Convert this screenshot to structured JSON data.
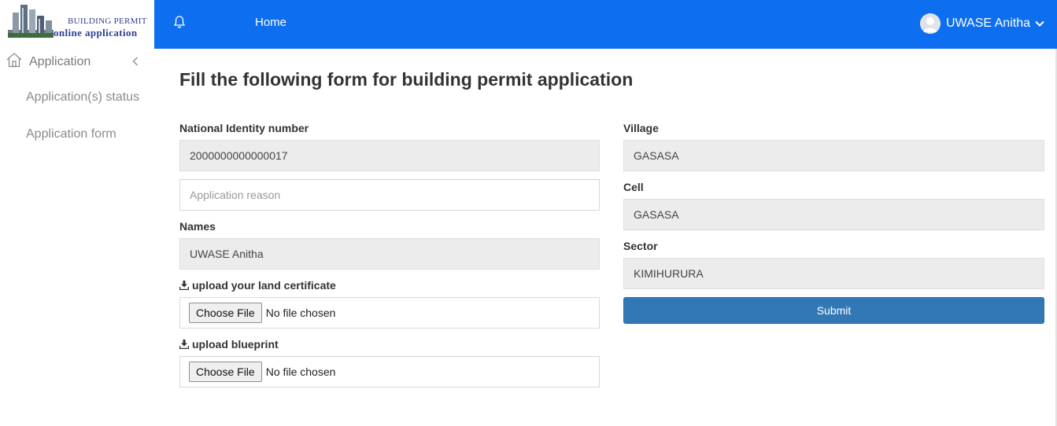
{
  "logo": {
    "line1": "BUILDING PERMIT",
    "line2": "online application"
  },
  "topbar": {
    "bell_icon": "bell-icon",
    "home_label": "Home",
    "user_name": "UWASE Anitha",
    "color": "#0d6ef0"
  },
  "sidebar": {
    "application_label": "Application",
    "items": [
      {
        "label": "Application(s) status"
      },
      {
        "label": "Application form"
      }
    ]
  },
  "form": {
    "title": "Fill the following form for building permit application",
    "national_id_label": "National Identity number",
    "national_id_value": "2000000000000017",
    "reason_placeholder": "Application reason",
    "names_label": "Names",
    "names_value": "UWASE Anitha",
    "land_cert_label": "upload your land certificate",
    "blueprint_label": "upload blueprint",
    "choose_file_label": "Choose File",
    "no_file_text": "No file chosen",
    "village_label": "Village",
    "village_value": "GASASA",
    "cell_label": "Cell",
    "cell_value": "GASASA",
    "sector_label": "Sector",
    "sector_value": "KIMIHURURA",
    "submit_label": "Submit",
    "submit_color": "#3278b5"
  }
}
